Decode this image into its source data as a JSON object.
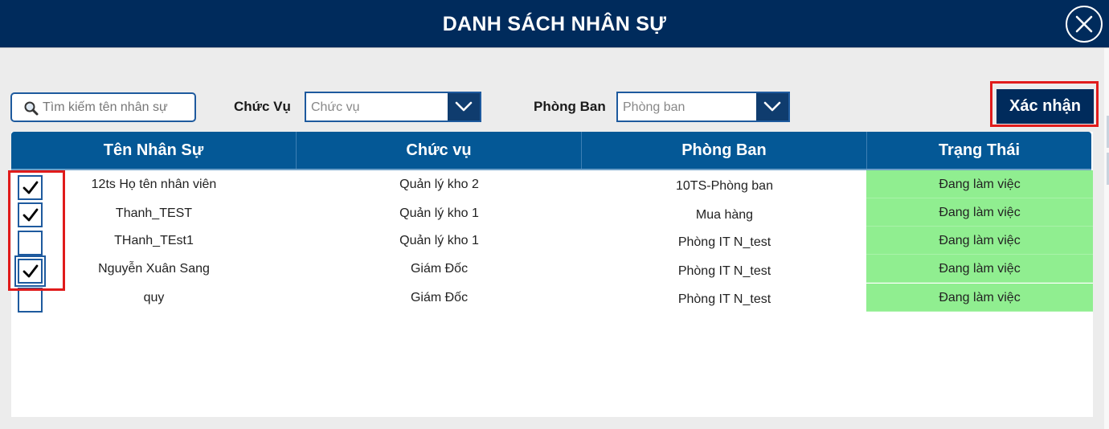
{
  "header": {
    "title": "DANH SÁCH NHÂN SỰ"
  },
  "filters": {
    "search_placeholder": "Tìm kiếm tên nhân sự",
    "position_label": "Chức Vụ",
    "position_placeholder": "Chức vụ",
    "department_label": "Phòng Ban",
    "department_placeholder": "Phòng ban"
  },
  "confirm_label": "Xác nhận",
  "table": {
    "columns": [
      "Tên Nhân Sự",
      "Chức vụ",
      "Phòng Ban",
      "Trạng Thái"
    ],
    "rows": [
      {
        "name": "12ts Họ tên nhân viên",
        "position": "Quản lý kho 2",
        "department": "10TS-Phòng ban",
        "status": "Đang làm việc",
        "checked": true
      },
      {
        "name": "Thanh_TEST",
        "position": "Quản lý kho 1",
        "department": "Mua hàng",
        "status": "Đang làm việc",
        "checked": true
      },
      {
        "name": "THanh_TEst1",
        "position": "Quản lý kho 1",
        "department": "Phòng IT N_test",
        "status": "Đang làm việc",
        "checked": false
      },
      {
        "name": "Nguyễn Xuân Sang",
        "position": "Giám Đốc",
        "department": "Phòng IT N_test",
        "status": "Đang làm việc",
        "checked": true
      },
      {
        "name": "quy",
        "position": "Giám Đốc",
        "department": "Phòng IT N_test",
        "status": "Đang làm việc",
        "checked": false
      }
    ]
  },
  "colors": {
    "header_bg": "#002b5c",
    "table_header_bg": "#045896",
    "status_bg": "#90ee90",
    "highlight": "#e01b1b"
  },
  "icons": [
    "close-icon",
    "search-icon",
    "chevron-down-icon",
    "checkmark-icon"
  ]
}
